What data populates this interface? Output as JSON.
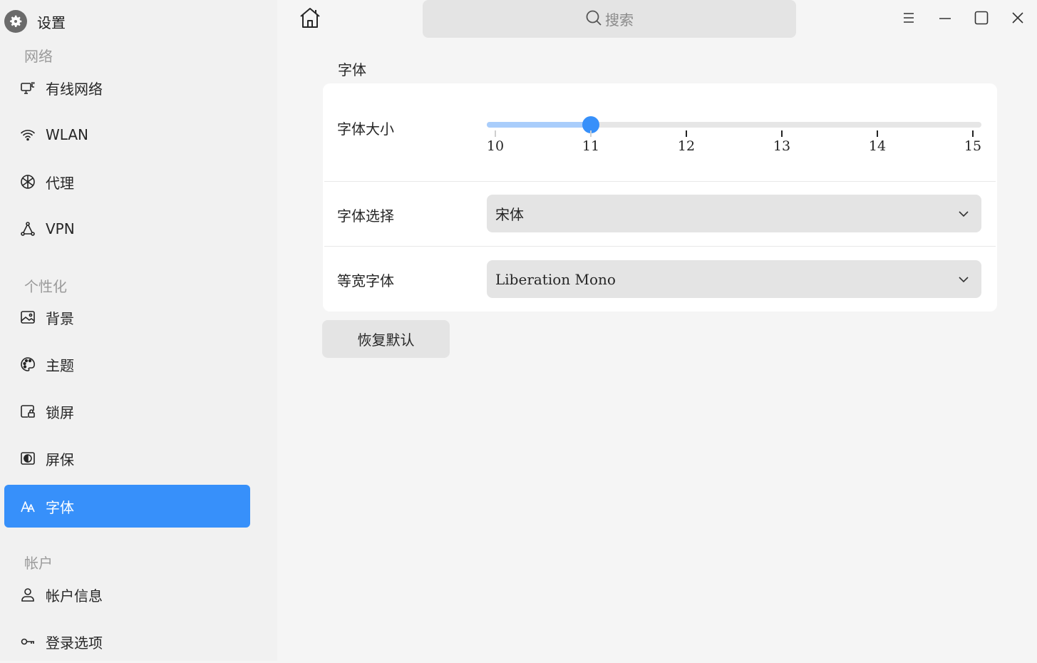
{
  "app": {
    "title": "设置",
    "icon": "gear-icon"
  },
  "sidebar": {
    "groups": [
      {
        "label": "网络",
        "items": [
          {
            "label": "有线网络",
            "icon": "wired-network-icon"
          },
          {
            "label": "WLAN",
            "icon": "wifi-icon"
          },
          {
            "label": "代理",
            "icon": "proxy-icon"
          },
          {
            "label": "VPN",
            "icon": "vpn-icon"
          }
        ]
      },
      {
        "label": "个性化",
        "items": [
          {
            "label": "背景",
            "icon": "background-icon"
          },
          {
            "label": "主题",
            "icon": "theme-palette-icon"
          },
          {
            "label": "锁屏",
            "icon": "lockscreen-icon"
          },
          {
            "label": "屏保",
            "icon": "screensaver-icon"
          },
          {
            "label": "字体",
            "icon": "font-icon",
            "active": true
          }
        ]
      },
      {
        "label": "帐户",
        "items": [
          {
            "label": "帐户信息",
            "icon": "user-icon"
          },
          {
            "label": "登录选项",
            "icon": "key-icon"
          }
        ]
      }
    ]
  },
  "topbar": {
    "home_icon": "home-icon",
    "search_placeholder": "搜索",
    "controls": [
      "menu-icon",
      "minimize-icon",
      "maximize-icon",
      "close-icon"
    ]
  },
  "main": {
    "section_title": "字体",
    "font_size": {
      "label": "字体大小",
      "ticks": [
        "10",
        "11",
        "12",
        "13",
        "14",
        "15"
      ],
      "min": 10,
      "max": 15,
      "value": 11
    },
    "font_select": {
      "label": "字体选择",
      "value": "宋体"
    },
    "mono_font": {
      "label": "等宽字体",
      "value": "Liberation Mono"
    },
    "restore_button": "恢复默认"
  },
  "colors": {
    "accent": "#3790fa",
    "sidebar_bg": "#f1f1f1",
    "content_bg": "#f5f5f5",
    "card_bg": "#ffffff"
  }
}
